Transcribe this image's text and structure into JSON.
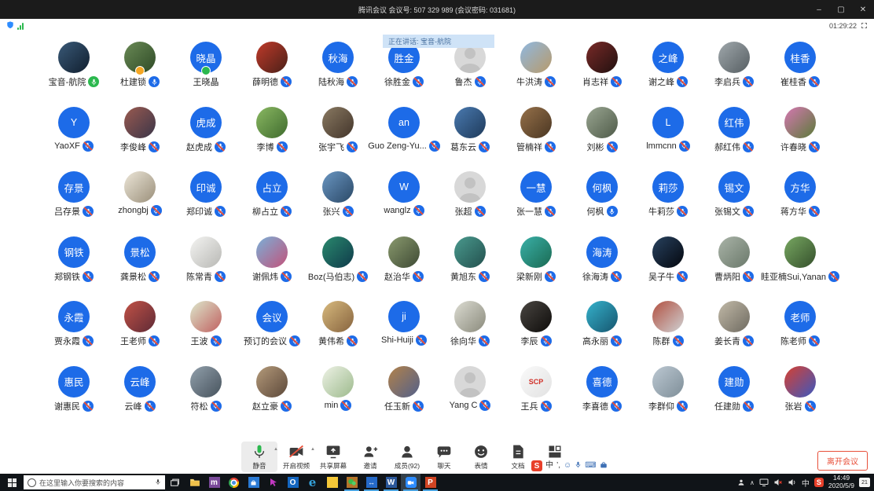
{
  "window": {
    "title": "腾讯会议 会议号: 507 329 989  (会议密码: 031681)",
    "controls": {
      "minimize": "–",
      "maximize": "▢",
      "close": "✕"
    }
  },
  "statusbar": {
    "timer": "01:29:22"
  },
  "banner": {
    "text": "正在讲话: 宝音-航院"
  },
  "colors": {
    "avatar_blue": "#1d6be8",
    "mic_muted_slash": "#e8503a",
    "speaking_green": "#2bb84e",
    "banner_bg": "#cfe3f7",
    "leave_red": "#e8503a",
    "taskbar_bg": "#101418"
  },
  "participants": [
    {
      "name": "宝音-航院",
      "type": "photo",
      "c1": "#3a5a78",
      "c2": "#101e2e",
      "mic": "speaking"
    },
    {
      "name": "杜建锁",
      "type": "photo",
      "c1": "#6a8a56",
      "c2": "#2e4a26",
      "mic": "on",
      "badge": "#f5a623"
    },
    {
      "name": "王晓晶",
      "type": "initials",
      "text": "晓晶",
      "mic": "none",
      "badge": "#2bb84e"
    },
    {
      "name": "薛明德",
      "type": "photo",
      "c1": "#c03a2a",
      "c2": "#4a2018",
      "mic": "muted"
    },
    {
      "name": "陆秋海",
      "type": "initials",
      "text": "秋海",
      "mic": "muted"
    },
    {
      "name": "徐胜金",
      "type": "initials",
      "text": "胜金",
      "mic": "muted"
    },
    {
      "name": "鲁杰",
      "type": "placeholder",
      "mic": "muted"
    },
    {
      "name": "牛洪涛",
      "type": "photo",
      "c1": "#8fb8e0",
      "c2": "#b89a6a",
      "mic": "muted"
    },
    {
      "name": "肖志祥",
      "type": "photo",
      "c1": "#7a2a28",
      "c2": "#20100f",
      "mic": "muted"
    },
    {
      "name": "谢之峰",
      "type": "initials",
      "text": "之峰",
      "mic": "muted"
    },
    {
      "name": "李启兵",
      "type": "photo",
      "c1": "#a0a8ac",
      "c2": "#565e62",
      "mic": "muted"
    },
    {
      "name": "崔桂香",
      "type": "initials",
      "text": "桂香",
      "mic": "muted"
    },
    {
      "name": "YaoXF",
      "type": "initials",
      "text": "Y",
      "mic": "muted"
    },
    {
      "name": "李俊峰",
      "type": "photo",
      "c1": "#9a5a50",
      "c2": "#3a3548",
      "mic": "muted"
    },
    {
      "name": "赵虎成",
      "type": "initials",
      "text": "虎成",
      "mic": "muted"
    },
    {
      "name": "李博",
      "type": "photo",
      "c1": "#8ab862",
      "c2": "#3f6b2e",
      "mic": "muted"
    },
    {
      "name": "张宇飞",
      "type": "photo",
      "c1": "#8a7a62",
      "c2": "#42342a",
      "mic": "muted"
    },
    {
      "name": "Guo Zeng-Yu...",
      "type": "initials",
      "text": "an",
      "mic": "muted"
    },
    {
      "name": "葛东云",
      "type": "photo",
      "c1": "#4a7ab0",
      "c2": "#1e3a5a",
      "mic": "muted"
    },
    {
      "name": "管楠祥",
      "type": "photo",
      "c1": "#96714a",
      "c2": "#4a3622",
      "mic": "muted"
    },
    {
      "name": "刘彬",
      "type": "photo",
      "c1": "#9aa692",
      "c2": "#4e5a48",
      "mic": "muted"
    },
    {
      "name": "lmmcnn",
      "type": "initials",
      "text": "L",
      "mic": "muted"
    },
    {
      "name": "郝红伟",
      "type": "initials",
      "text": "红伟",
      "mic": "muted"
    },
    {
      "name": "许春晓",
      "type": "photo",
      "c1": "#d678b2",
      "c2": "#5a7a38",
      "mic": "muted"
    },
    {
      "name": "吕存景",
      "type": "initials",
      "text": "存景",
      "mic": "muted"
    },
    {
      "name": "zhongbj",
      "type": "photo",
      "c1": "#ece6d8",
      "c2": "#9a8f7a",
      "mic": "muted"
    },
    {
      "name": "郑印诚",
      "type": "initials",
      "text": "印诚",
      "mic": "muted"
    },
    {
      "name": "柳占立",
      "type": "initials",
      "text": "占立",
      "mic": "muted"
    },
    {
      "name": "张兴",
      "type": "photo",
      "c1": "#6a96c2",
      "c2": "#2a4866",
      "mic": "muted"
    },
    {
      "name": "wanglz",
      "type": "initials",
      "text": "W",
      "mic": "muted"
    },
    {
      "name": "张超",
      "type": "placeholder",
      "mic": "muted"
    },
    {
      "name": "张一慧",
      "type": "initials",
      "text": "一慧",
      "mic": "muted"
    },
    {
      "name": "何枫",
      "type": "initials",
      "text": "何枫",
      "mic": "on"
    },
    {
      "name": "牛莉莎",
      "type": "initials",
      "text": "莉莎",
      "mic": "muted"
    },
    {
      "name": "张锡文",
      "type": "initials",
      "text": "锡文",
      "mic": "muted"
    },
    {
      "name": "蒋方华",
      "type": "initials",
      "text": "方华",
      "mic": "muted"
    },
    {
      "name": "郑钢铁",
      "type": "initials",
      "text": "钢铁",
      "mic": "muted"
    },
    {
      "name": "龚景松",
      "type": "initials",
      "text": "景松",
      "mic": "muted"
    },
    {
      "name": "陈常青",
      "type": "photo",
      "c1": "#f4f4f2",
      "c2": "#b8b8b4",
      "mic": "muted"
    },
    {
      "name": "谢佩炜",
      "type": "photo",
      "c1": "#7ab0d8",
      "c2": "#c2527a",
      "mic": "muted"
    },
    {
      "name": "Boz(马伯志)",
      "type": "photo",
      "c1": "#2a8a6e",
      "c2": "#0f3a4a",
      "mic": "muted"
    },
    {
      "name": "赵治华",
      "type": "photo",
      "c1": "#8a9a6e",
      "c2": "#3e4a34",
      "mic": "muted"
    },
    {
      "name": "黄旭东",
      "type": "photo",
      "c1": "#4a9a8e",
      "c2": "#23504e",
      "mic": "muted"
    },
    {
      "name": "梁新刚",
      "type": "photo",
      "c1": "#3ab0a8",
      "c2": "#1a6a52",
      "mic": "muted"
    },
    {
      "name": "徐海涛",
      "type": "initials",
      "text": "海涛",
      "mic": "muted"
    },
    {
      "name": "吴子牛",
      "type": "photo",
      "c1": "#28425f",
      "c2": "#04070e",
      "mic": "muted"
    },
    {
      "name": "曹炳阳",
      "type": "photo",
      "c1": "#aab4a8",
      "c2": "#6a786a",
      "mic": "muted"
    },
    {
      "name": "眭亚楠Sui,Yanan",
      "type": "photo",
      "c1": "#78a862",
      "c2": "#344f2b",
      "mic": "muted"
    },
    {
      "name": "贾永霞",
      "type": "initials",
      "text": "永霞",
      "mic": "muted"
    },
    {
      "name": "王老师",
      "type": "photo",
      "c1": "#c25246",
      "c2": "#5e2a36",
      "mic": "muted"
    },
    {
      "name": "王波",
      "type": "photo",
      "c1": "#dde8cc",
      "c2": "#c06060",
      "mic": "muted"
    },
    {
      "name": "预订的会议",
      "type": "initials",
      "text": "会议",
      "mic": "muted"
    },
    {
      "name": "黄伟希",
      "type": "photo",
      "c1": "#d8ba7e",
      "c2": "#86633e",
      "mic": "muted"
    },
    {
      "name": "Shi-Huiji",
      "type": "initials",
      "text": "ji",
      "mic": "muted"
    },
    {
      "name": "徐向华",
      "type": "photo",
      "c1": "#dcdcd2",
      "c2": "#8a8a7c",
      "mic": "muted"
    },
    {
      "name": "李辰",
      "type": "photo",
      "c1": "#4a4642",
      "c2": "#0e0c0a",
      "mic": "muted"
    },
    {
      "name": "高永丽",
      "type": "photo",
      "c1": "#35b2cc",
      "c2": "#16556e",
      "mic": "muted"
    },
    {
      "name": "陈群",
      "type": "photo",
      "c1": "#b25040",
      "c2": "#cfd2d4",
      "mic": "muted"
    },
    {
      "name": "姜长青",
      "type": "photo",
      "c1": "#c2baa8",
      "c2": "#6e6a60",
      "mic": "muted"
    },
    {
      "name": "陈老师",
      "type": "initials",
      "text": "老师",
      "mic": "muted"
    },
    {
      "name": "谢惠民",
      "type": "initials",
      "text": "惠民",
      "mic": "muted"
    },
    {
      "name": "云峰",
      "type": "initials",
      "text": "云峰",
      "mic": "muted"
    },
    {
      "name": "符松",
      "type": "photo",
      "c1": "#92a0ac",
      "c2": "#46525c",
      "mic": "muted"
    },
    {
      "name": "赵立豪",
      "type": "photo",
      "c1": "#b49a7a",
      "c2": "#5c483a",
      "mic": "muted"
    },
    {
      "name": "min",
      "type": "photo",
      "c1": "#eef2e6",
      "c2": "#9cba8c",
      "mic": "muted"
    },
    {
      "name": "任玉新",
      "type": "photo",
      "c1": "#b2824a",
      "c2": "#52608a",
      "mic": "muted"
    },
    {
      "name": "Yang C",
      "type": "placeholder",
      "mic": "muted"
    },
    {
      "name": "王兵",
      "type": "photo",
      "c1": "#fafafa",
      "c2": "#e2e2e2",
      "ptext": "SCP",
      "ptextcolor": "#d03028",
      "mic": "muted"
    },
    {
      "name": "李喜德",
      "type": "initials",
      "text": "喜德",
      "mic": "muted"
    },
    {
      "name": "李群仰",
      "type": "photo",
      "c1": "#bcc8d2",
      "c2": "#7e8e98",
      "mic": "muted"
    },
    {
      "name": "任建勋",
      "type": "initials",
      "text": "建勋",
      "mic": "muted"
    },
    {
      "name": "张岩",
      "type": "photo",
      "c1": "#d84030",
      "c2": "#3a58c0",
      "mic": "muted"
    }
  ],
  "toolbar": {
    "items": [
      {
        "id": "mute",
        "label": "静音",
        "caret": true,
        "active": true
      },
      {
        "id": "video",
        "label": "开启视频",
        "caret": true
      },
      {
        "id": "share",
        "label": "共享屏幕"
      },
      {
        "id": "invite",
        "label": "邀请"
      },
      {
        "id": "members",
        "label": "成员(92)"
      },
      {
        "id": "chat",
        "label": "聊天"
      },
      {
        "id": "emoji",
        "label": "表情"
      },
      {
        "id": "docs",
        "label": "文档"
      },
      {
        "id": "layout",
        "label": ""
      }
    ],
    "leave_label": "离开会议"
  },
  "ime": {
    "sogou": "S",
    "lang": "中",
    "punct": "’,",
    "emoji": "☺",
    "keyboard": "⌨"
  },
  "taskbar": {
    "search_placeholder": "在这里输入你要搜索的内容",
    "apps": [
      {
        "id": "task-view"
      },
      {
        "id": "file-explorer"
      },
      {
        "id": "app-purple",
        "letter": "m"
      },
      {
        "id": "chrome"
      },
      {
        "id": "ms-store"
      },
      {
        "id": "pointer-app"
      },
      {
        "id": "outlook",
        "letter": "O"
      },
      {
        "id": "edge",
        "letter": "e"
      },
      {
        "id": "sticky-notes"
      },
      {
        "id": "wechat",
        "running": true
      },
      {
        "id": "teamviewer",
        "letter": "↔",
        "running": true
      },
      {
        "id": "word",
        "letter": "W",
        "running": true
      },
      {
        "id": "tencent-meeting",
        "running": true,
        "focus": true
      },
      {
        "id": "powerpoint",
        "letter": "P",
        "running": true
      }
    ],
    "tray": {
      "ime": "中",
      "sogou": "S",
      "clock_time": "14:49",
      "clock_date": "2020/5/9",
      "badge": "21"
    }
  }
}
